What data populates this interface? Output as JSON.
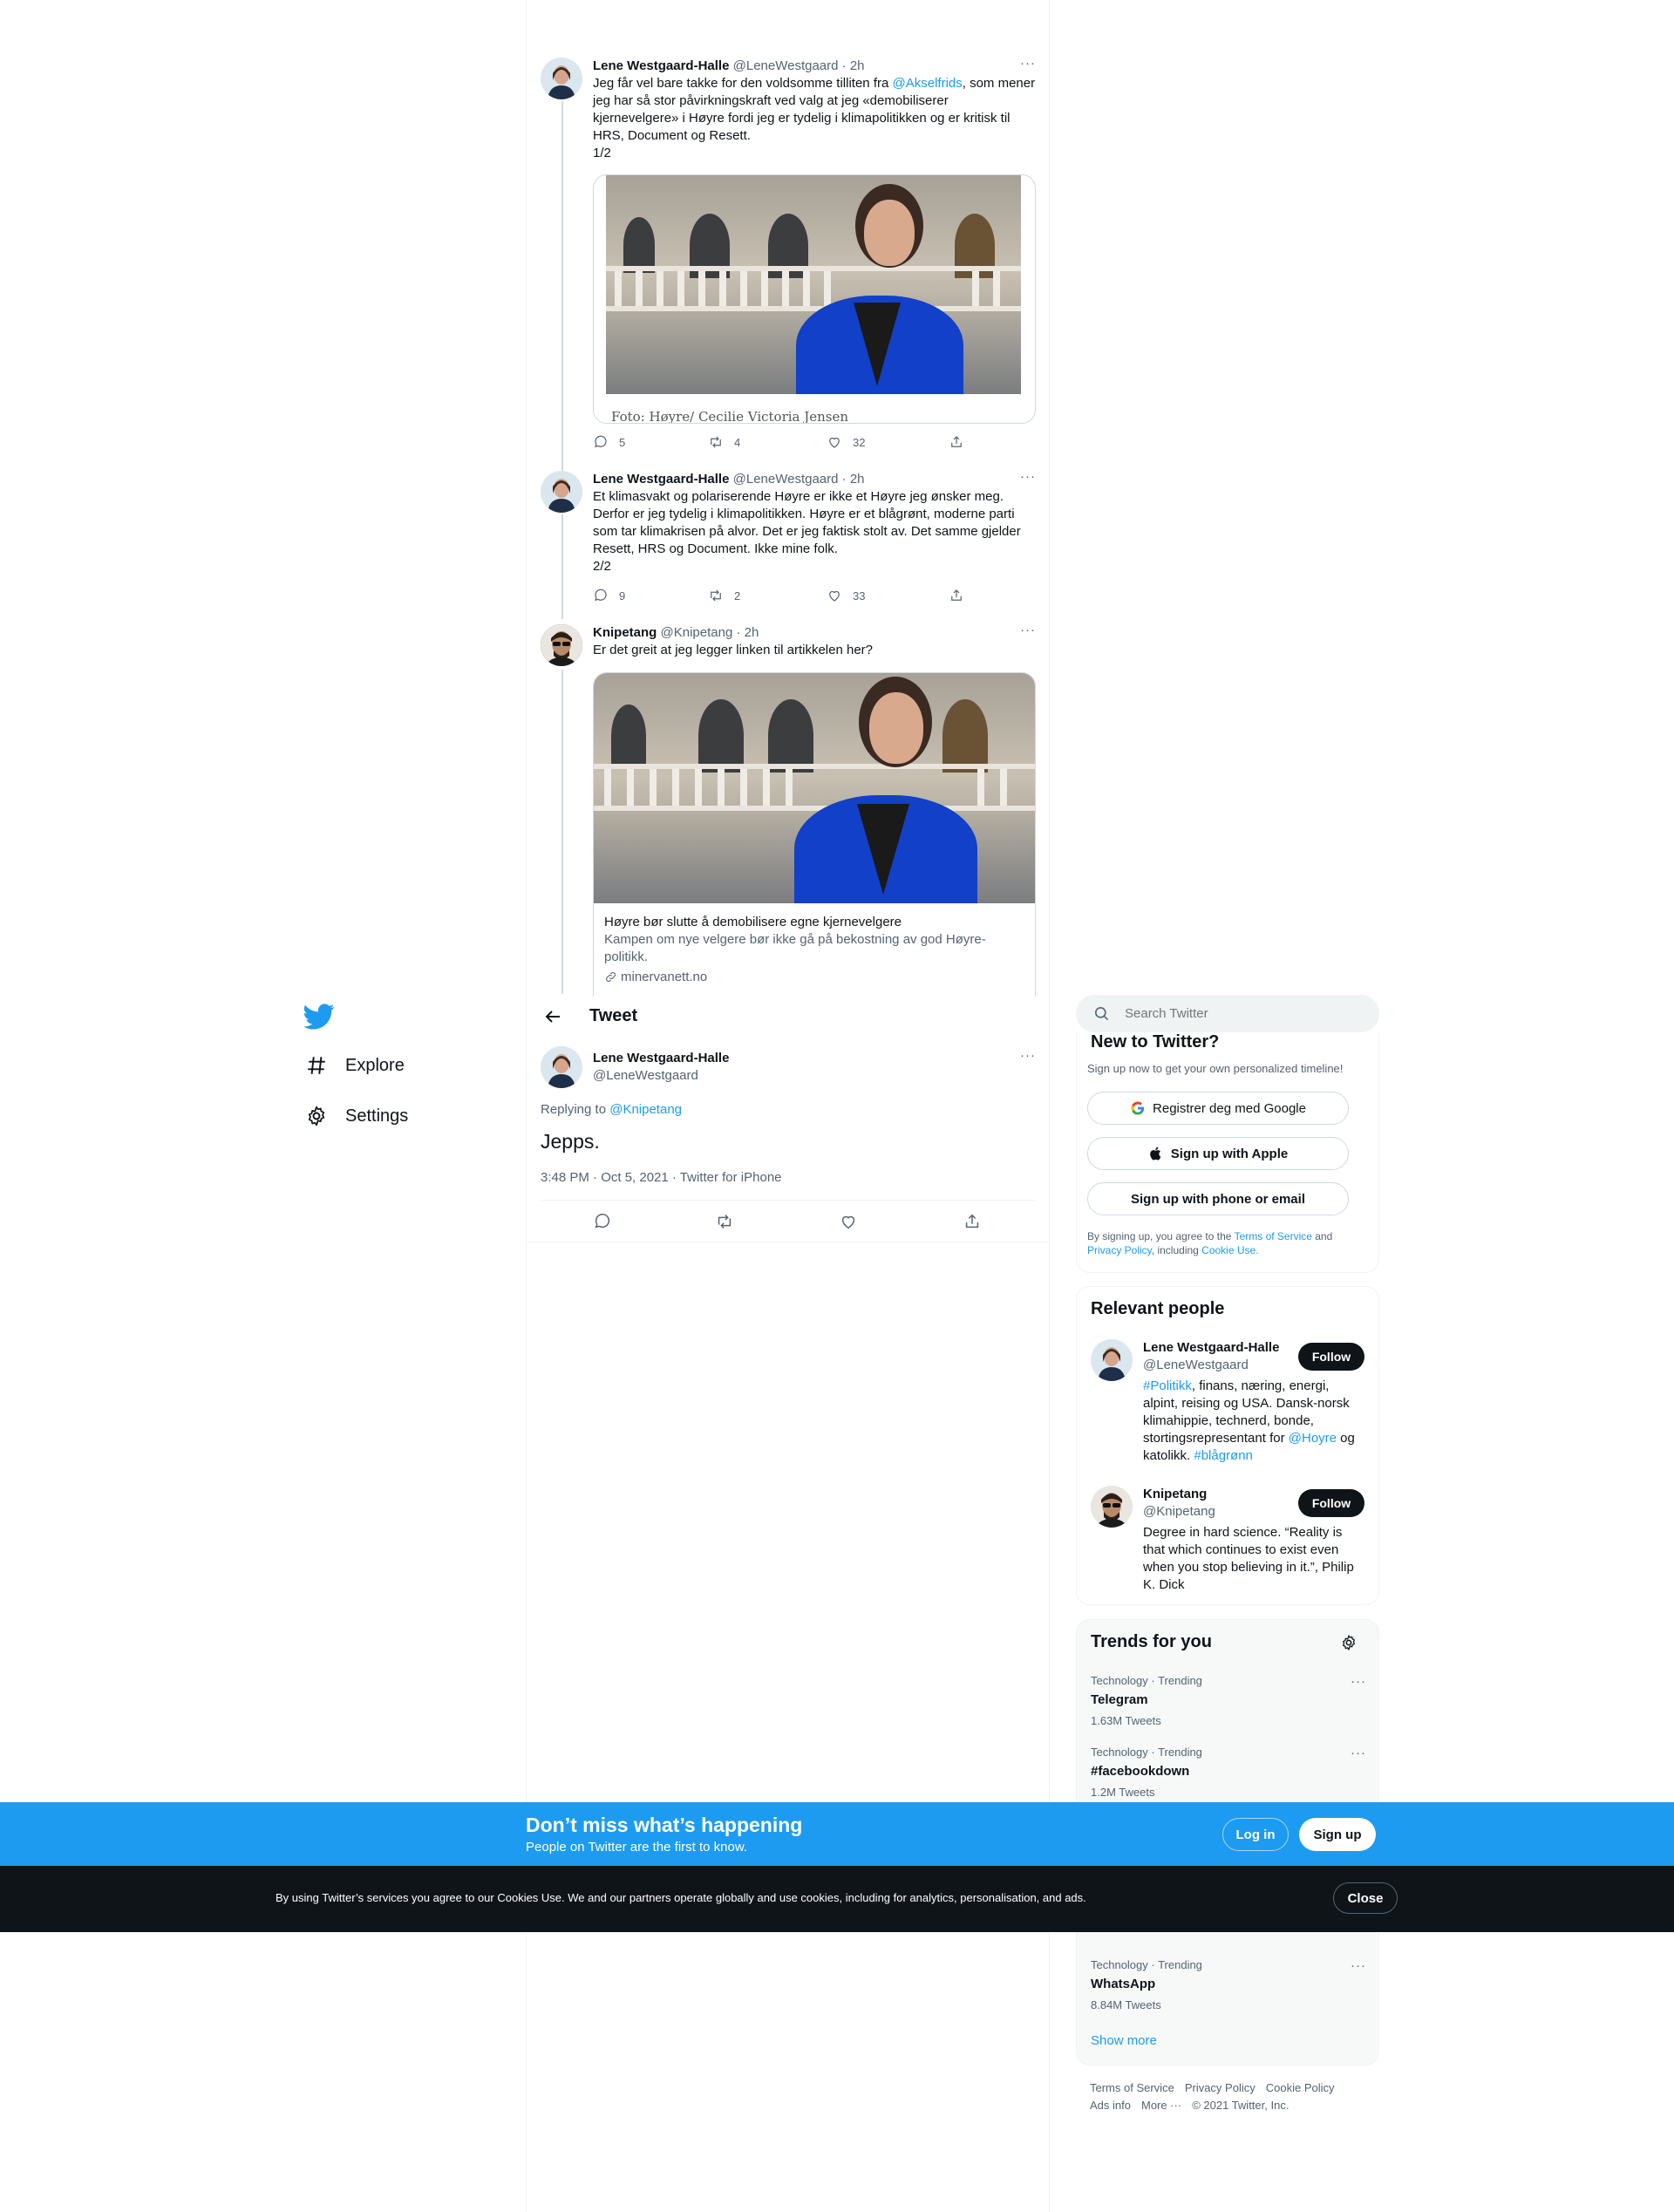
{
  "thread": [
    {
      "name": "Lene Westgaard-Halle",
      "handle": "@LeneWestgaard",
      "time": "· 2h",
      "text_pre": "Jeg får vel bare takke for den voldsomme tilliten fra ",
      "mention": "@Akselfrids",
      "text_post": ", som mener\njeg har så stor påvirkningskraft ved valg at jeg «demobiliserer\nkjernevelgere» i Høyre fordi jeg er tydelig i klimapolitikken og er kritisk til\nHRS, Document og Resett.\n1/2",
      "photo_caption": "Foto: Høyre/ Cecilie Victoria Jensen",
      "replies": "5",
      "retweets": "4",
      "likes": "32"
    },
    {
      "name": "Lene Westgaard-Halle",
      "handle": "@LeneWestgaard",
      "time": "· 2h",
      "text": "Et klimasvakt og polariserende Høyre er ikke et Høyre jeg ønsker meg.\nDerfor er jeg tydelig i klimapolitikken. Høyre er et blågrønt, moderne parti\nsom tar klimakrisen på alvor. Det er jeg faktisk stolt av. Det samme gjelder\nResett, HRS og Document. Ikke mine folk.\n2/2",
      "replies": "9",
      "retweets": "2",
      "likes": "33"
    },
    {
      "name": "Knipetang",
      "handle": "@Knipetang",
      "time": "· 2h",
      "text": "Er det greit at jeg legger linken til artikkelen her?",
      "card_title": "Høyre bør slutte å demobilisere egne kjernevelgere",
      "card_desc": "Kampen om nye velgere bør ikke gå på bekostning av god Høyre-\npolitikk.",
      "card_domain": "minervanett.no"
    }
  ],
  "nav": {
    "explore": "Explore",
    "settings": "Settings"
  },
  "main": {
    "header": "Tweet",
    "name": "Lene Westgaard-Halle",
    "handle": "@LeneWestgaard",
    "replying_to": "Replying to ",
    "replying_handle": "@Knipetang",
    "text": "Jepps.",
    "timestamp": "3:48 PM · Oct 5, 2021 · Twitter for iPhone"
  },
  "search": {
    "placeholder": "Search Twitter"
  },
  "signup": {
    "title": "New to Twitter?",
    "subtitle": "Sign up now to get your own personalized timeline!",
    "google": "Registrer deg med Google",
    "apple": "Sign up with Apple",
    "phone": "Sign up with phone or email",
    "legal_1": "By signing up, you agree to the ",
    "terms": "Terms of Service",
    "legal_2": " and",
    "privacy": "Privacy Policy",
    "legal_3": ", including ",
    "cookie": "Cookie Use."
  },
  "relevant": {
    "title": "Relevant people",
    "follow": "Follow",
    "people": [
      {
        "name": "Lene Westgaard-Halle",
        "handle": "@LeneWestgaard",
        "bio_tag": "#Politikk",
        "bio_1": ", finans, næring, energi,\nalpint, reising og USA. Dansk-norsk\nklimahippie, technerd, bonde,\nstortingsrepresentant for ",
        "bio_mention": "@Hoyre",
        "bio_2": " og\nkatolikk. ",
        "bio_tag2": "#blågrønn"
      },
      {
        "name": "Knipetang",
        "handle": "@Knipetang",
        "bio": "Degree in hard science. “Reality is\nthat which continues to exist even\nwhen you stop believing in it.”, Philip\nK. Dick"
      }
    ]
  },
  "trends": {
    "title": "Trends for you",
    "items": [
      {
        "meta": "Technology · Trending",
        "name": "Telegram",
        "count": "1.63M Tweets"
      },
      {
        "meta": "Technology · Trending",
        "name": "#facebookdown",
        "count": "1.2M Tweets"
      },
      {
        "meta": "Technology · Trending",
        "name": "WhatsApp",
        "count": "8.84M Tweets"
      }
    ],
    "show_more": "Show more"
  },
  "footer": {
    "terms": "Terms of Service",
    "privacy": "Privacy Policy",
    "cookie": "Cookie Policy",
    "ads": "Ads info",
    "more": "More ···",
    "copyright": "© 2021 Twitter, Inc."
  },
  "banner": {
    "headline": "Don’t miss what’s happening",
    "sub": "People on Twitter are the first to know.",
    "login": "Log in",
    "signup": "Sign up"
  },
  "cookie_bar": {
    "text": "By using Twitter’s services you agree to our Cookies Use. We and our partners operate globally and use cookies, including for analytics, personalisation, and ads.",
    "close": "Close"
  },
  "colors": {
    "accent": "#1d9bf0",
    "text": "#0f1419",
    "muted": "#536471",
    "cookie_bg": "#0f1419"
  }
}
